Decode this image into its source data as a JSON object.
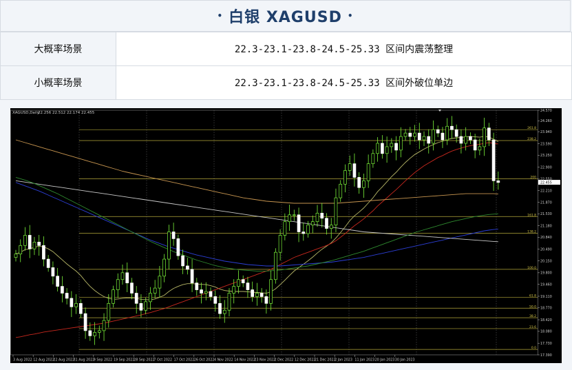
{
  "header": {
    "dot_left": "•",
    "title": "白银 XAGUSD",
    "dot_right": "•"
  },
  "scenarios": [
    {
      "label": "大概率场景",
      "value": "22.3-23.1-23.8-24.5-25.33 区间内震荡整理"
    },
    {
      "label": "小概率场景",
      "value": "22.3-23.1-23.8-24.5-25.33 区间外破位单边"
    }
  ],
  "chart_data": {
    "type": "candlestick",
    "title": "XAGUSD,Daily",
    "ohlc_label": "22.256 22.512 22.174 22.455",
    "current_price": "22.455",
    "y_ticks": [
      "24.570",
      "24.260",
      "23.940",
      "23.590",
      "23.250",
      "22.900",
      "22.550",
      "22.210",
      "21.870",
      "21.530",
      "21.180",
      "20.840",
      "20.490",
      "20.150",
      "19.800",
      "19.460",
      "19.110",
      "18.770",
      "18.420",
      "18.080",
      "17.730",
      "17.390"
    ],
    "x_labels": [
      "3 Aug 2022",
      "12 Aug 2022",
      "22 Aug 2022",
      "31 Aug 2022",
      "9 Sep 2022",
      "19 Sep 2022",
      "28 Sep 2022",
      "7 Oct 2022",
      "17 Oct 2022",
      "26 Oct 2022",
      "4 Nov 2022",
      "14 Nov 2022",
      "23 Nov 2022",
      "2 Dec 2022",
      "12 Dec 2022",
      "21 Dec 2022",
      "2 Jan 2023",
      "11 Jan 2023",
      "20 Jan 2023",
      "30 Jan 2023"
    ],
    "fib_levels": [
      {
        "label": "261.8",
        "price": 24.0
      },
      {
        "label": "238.2",
        "price": 23.68
      },
      {
        "label": "200",
        "price": 22.56
      },
      {
        "label": "161.8",
        "price": 21.45
      },
      {
        "label": "138.2",
        "price": 20.96
      },
      {
        "label": "100.0",
        "price": 19.9
      },
      {
        "label": "61.8",
        "price": 19.08
      },
      {
        "label": "50.0",
        "price": 18.76
      },
      {
        "label": "38.2",
        "price": 18.48
      },
      {
        "label": "23.6",
        "price": 18.16
      },
      {
        "label": "0.0",
        "price": 17.55
      }
    ],
    "closes": [
      20.35,
      20.6,
      20.9,
      20.5,
      20.7,
      20.6,
      20.2,
      19.95,
      19.7,
      19.4,
      19.2,
      19.05,
      18.8,
      18.9,
      18.6,
      18.1,
      17.95,
      18.05,
      18.1,
      18.4,
      18.9,
      19.3,
      19.6,
      19.8,
      19.5,
      19.2,
      18.9,
      18.7,
      18.95,
      19.2,
      19.35,
      19.7,
      20.2,
      21.0,
      20.8,
      20.3,
      20.0,
      19.9,
      19.5,
      19.3,
      19.2,
      19.25,
      19.1,
      18.9,
      18.6,
      18.7,
      19.2,
      19.4,
      19.6,
      19.5,
      19.3,
      19.1,
      19.2,
      19.1,
      18.9,
      19.6,
      20.4,
      20.9,
      21.3,
      21.5,
      21.5,
      21.0,
      20.95,
      21.2,
      21.3,
      21.55,
      21.4,
      21.1,
      21.2,
      22.0,
      22.4,
      22.8,
      23.0,
      22.6,
      22.3,
      22.5,
      23.0,
      23.3,
      23.6,
      23.3,
      23.5,
      23.6,
      23.4,
      23.8,
      23.9,
      23.8,
      23.9,
      23.7,
      23.8,
      23.6,
      24.0,
      23.9,
      23.7,
      24.1,
      24.0,
      23.8,
      23.6,
      23.8,
      23.7,
      23.4,
      23.5,
      24.05,
      23.7,
      22.5,
      22.45
    ],
    "moving_averages": [
      {
        "color": "#b8b868",
        "values": [
          20.35,
          20.4,
          20.48,
          20.5,
          20.55,
          20.58,
          20.56,
          20.5,
          20.42,
          20.3,
          20.18,
          20.06,
          19.95,
          19.85,
          19.72,
          19.55,
          19.4,
          19.28,
          19.18,
          19.1,
          19.05,
          19.02,
          19.03,
          19.05,
          19.06,
          19.06,
          19.05,
          19.02,
          19.01,
          19.01,
          19.03,
          19.08,
          19.14,
          19.25,
          19.34,
          19.4,
          19.45,
          19.48,
          19.48,
          19.47,
          19.46,
          19.45,
          19.42,
          19.38,
          19.32,
          19.28,
          19.26,
          19.25,
          19.25,
          19.25,
          19.24,
          19.23,
          19.22,
          19.21,
          19.2,
          19.24,
          19.33,
          19.45,
          19.58,
          19.72,
          19.85,
          19.95,
          20.05,
          20.15,
          20.26,
          20.38,
          20.49,
          20.58,
          20.68,
          20.82,
          20.98,
          21.15,
          21.33,
          21.47,
          21.58,
          21.7,
          21.85,
          22.0,
          22.18,
          22.32,
          22.47,
          22.62,
          22.75,
          22.9,
          23.04,
          23.16,
          23.27,
          23.35,
          23.43,
          23.5,
          23.56,
          23.62,
          23.66,
          23.71,
          23.74,
          23.76,
          23.77,
          23.79,
          23.8,
          23.79,
          23.78,
          23.8,
          23.78,
          23.72,
          23.65
        ]
      },
      {
        "color": "#c8281e",
        "values": [
          17.9,
          17.92,
          17.95,
          17.98,
          18.0,
          18.03,
          18.06,
          18.08,
          18.1,
          18.12,
          18.14,
          18.16,
          18.18,
          18.2,
          18.22,
          18.24,
          18.26,
          18.28,
          18.3,
          18.32,
          18.35,
          18.38,
          18.41,
          18.44,
          18.47,
          18.5,
          18.53,
          18.56,
          18.6,
          18.63,
          18.67,
          18.71,
          18.75,
          18.8,
          18.85,
          18.9,
          18.95,
          19.0,
          19.05,
          19.1,
          19.15,
          19.2,
          19.25,
          19.3,
          19.35,
          19.4,
          19.45,
          19.5,
          19.55,
          19.6,
          19.65,
          19.7,
          19.75,
          19.8,
          19.85,
          19.9,
          19.97,
          20.04,
          20.11,
          20.18,
          20.25,
          20.3,
          20.35,
          20.4,
          20.45,
          20.5,
          20.55,
          20.6,
          20.66,
          20.74,
          20.84,
          20.95,
          21.07,
          21.18,
          21.28,
          21.38,
          21.5,
          21.62,
          21.76,
          21.88,
          22.0,
          22.12,
          22.24,
          22.37,
          22.5,
          22.62,
          22.74,
          22.84,
          22.94,
          23.02,
          23.1,
          23.18,
          23.24,
          23.31,
          23.37,
          23.42,
          23.46,
          23.5,
          23.53,
          23.55,
          23.57,
          23.6,
          23.62,
          23.6,
          23.58
        ]
      },
      {
        "color": "#2c3fd6",
        "values": [
          22.45,
          22.4,
          22.35,
          22.3,
          22.25,
          22.2,
          22.14,
          22.08,
          22.02,
          21.96,
          21.9,
          21.84,
          21.78,
          21.72,
          21.66,
          21.6,
          21.54,
          21.48,
          21.42,
          21.36,
          21.3,
          21.24,
          21.18,
          21.12,
          21.06,
          21.0,
          20.94,
          20.88,
          20.82,
          20.76,
          20.71,
          20.66,
          20.61,
          20.56,
          20.52,
          20.48,
          20.44,
          20.4,
          20.36,
          20.32,
          20.29,
          20.26,
          20.23,
          20.2,
          20.17,
          20.14,
          20.12,
          20.1,
          20.08,
          20.06,
          20.04,
          20.03,
          20.02,
          20.01,
          20.0,
          20.0,
          20.0,
          20.0,
          20.01,
          20.02,
          20.03,
          20.04,
          20.05,
          20.06,
          20.07,
          20.08,
          20.09,
          20.1,
          20.11,
          20.13,
          20.15,
          20.17,
          20.19,
          20.21,
          20.23,
          20.25,
          20.28,
          20.31,
          20.34,
          20.37,
          20.4,
          20.43,
          20.46,
          20.49,
          20.52,
          20.55,
          20.58,
          20.61,
          20.64,
          20.67,
          20.7,
          20.73,
          20.76,
          20.79,
          20.82,
          20.85,
          20.88,
          20.91,
          20.94,
          20.97,
          21.0,
          21.03,
          21.05,
          21.07,
          21.08
        ]
      },
      {
        "color": "#c8c8c8",
        "values": [
          22.5,
          22.48,
          22.46,
          22.44,
          22.42,
          22.4,
          22.38,
          22.36,
          22.34,
          22.32,
          22.3,
          22.28,
          22.26,
          22.24,
          22.22,
          22.2,
          22.18,
          22.16,
          22.14,
          22.12,
          22.1,
          22.08,
          22.06,
          22.04,
          22.02,
          22.0,
          21.98,
          21.96,
          21.94,
          21.92,
          21.9,
          21.88,
          21.86,
          21.84,
          21.82,
          21.8,
          21.78,
          21.76,
          21.74,
          21.72,
          21.7,
          21.68,
          21.66,
          21.64,
          21.62,
          21.6,
          21.58,
          21.56,
          21.54,
          21.52,
          21.5,
          21.48,
          21.46,
          21.44,
          21.42,
          21.4,
          21.38,
          21.36,
          21.34,
          21.32,
          21.3,
          21.28,
          21.26,
          21.24,
          21.22,
          21.2,
          21.18,
          21.16,
          21.14,
          21.12,
          21.1,
          21.08,
          21.06,
          21.04,
          21.02,
          21.0,
          20.99,
          20.98,
          20.97,
          20.96,
          20.95,
          20.94,
          20.93,
          20.92,
          20.91,
          20.9,
          20.89,
          20.88,
          20.87,
          20.86,
          20.85,
          20.84,
          20.83,
          20.82,
          20.81,
          20.8,
          20.79,
          20.78,
          20.77,
          20.76,
          20.75,
          20.74,
          20.73,
          20.72,
          20.71
        ]
      },
      {
        "color": "#c89650",
        "values": [
          23.7,
          23.66,
          23.62,
          23.58,
          23.54,
          23.5,
          23.46,
          23.42,
          23.38,
          23.34,
          23.3,
          23.26,
          23.22,
          23.18,
          23.14,
          23.1,
          23.06,
          23.02,
          22.98,
          22.94,
          22.9,
          22.86,
          22.82,
          22.78,
          22.75,
          22.72,
          22.69,
          22.66,
          22.63,
          22.6,
          22.57,
          22.54,
          22.51,
          22.48,
          22.45,
          22.42,
          22.39,
          22.36,
          22.33,
          22.3,
          22.27,
          22.24,
          22.21,
          22.18,
          22.15,
          22.12,
          22.09,
          22.06,
          22.03,
          22.0,
          21.98,
          21.96,
          21.94,
          21.92,
          21.9,
          21.89,
          21.88,
          21.87,
          21.86,
          21.85,
          21.84,
          21.84,
          21.84,
          21.84,
          21.84,
          21.84,
          21.84,
          21.84,
          21.84,
          21.84,
          21.85,
          21.86,
          21.87,
          21.88,
          21.89,
          21.9,
          21.91,
          21.92,
          21.93,
          21.94,
          21.95,
          21.96,
          21.97,
          21.98,
          21.99,
          22.0,
          22.01,
          22.02,
          22.03,
          22.04,
          22.05,
          22.06,
          22.07,
          22.08,
          22.09,
          22.1,
          22.11,
          22.12,
          22.12,
          22.12,
          22.12,
          22.12,
          22.12,
          22.12,
          22.11
        ]
      },
      {
        "color": "#2f8a2f",
        "values": [
          22.6,
          22.56,
          22.52,
          22.47,
          22.42,
          22.36,
          22.3,
          22.24,
          22.18,
          22.12,
          22.05,
          21.98,
          21.91,
          21.84,
          21.77,
          21.7,
          21.63,
          21.56,
          21.49,
          21.42,
          21.35,
          21.28,
          21.21,
          21.14,
          21.07,
          21.0,
          20.93,
          20.86,
          20.79,
          20.72,
          20.66,
          20.6,
          20.54,
          20.48,
          20.42,
          20.37,
          20.32,
          20.27,
          20.22,
          20.17,
          20.13,
          20.09,
          20.05,
          20.01,
          19.98,
          19.95,
          19.93,
          19.91,
          19.89,
          19.88,
          19.87,
          19.86,
          19.85,
          19.85,
          19.85,
          19.86,
          19.87,
          19.88,
          19.9,
          19.92,
          19.94,
          19.96,
          19.98,
          20.0,
          20.03,
          20.06,
          20.09,
          20.12,
          20.15,
          20.19,
          20.23,
          20.27,
          20.31,
          20.35,
          20.39,
          20.43,
          20.48,
          20.53,
          20.58,
          20.63,
          20.68,
          20.73,
          20.78,
          20.83,
          20.88,
          20.93,
          20.98,
          21.02,
          21.06,
          21.1,
          21.14,
          21.18,
          21.22,
          21.26,
          21.3,
          21.33,
          21.36,
          21.39,
          21.42,
          21.45,
          21.47,
          21.49,
          21.51,
          21.52,
          21.53
        ]
      }
    ]
  }
}
